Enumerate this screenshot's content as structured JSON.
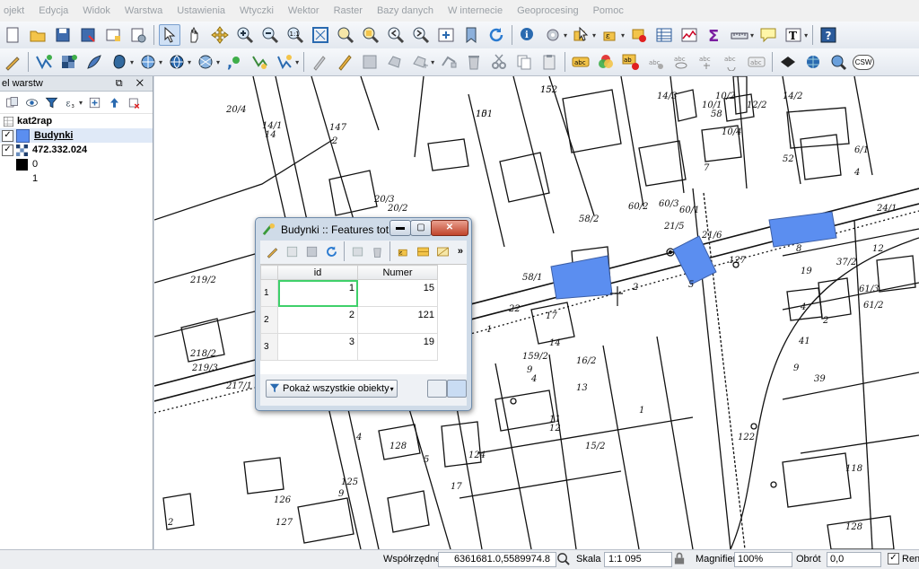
{
  "menu": [
    "ojekt",
    "Edycja",
    "Widok",
    "Warstwa",
    "Ustawienia",
    "Wtyczki",
    "Wektor",
    "Raster",
    "Bazy danych",
    "W internecie",
    "Geoprocesing",
    "Pomoc"
  ],
  "toolbar2": {
    "csw_label": "CSW"
  },
  "layers_panel": {
    "title": "el warstw",
    "controls": "⧉ ✕",
    "layers": [
      {
        "name": "kat2rap",
        "checked": false,
        "visible_check": false
      },
      {
        "name": "Budynki",
        "checked": true,
        "color": "#5b8ef0"
      },
      {
        "name": "472.332.024",
        "checked": true
      },
      {
        "legend": "0",
        "color": "#000000"
      },
      {
        "legend": "1",
        "color": "#ffffff"
      }
    ]
  },
  "attribute_window": {
    "title": "Budynki :: Features tot...",
    "more": "»",
    "columns": [
      "id",
      "Numer"
    ],
    "rows": [
      {
        "row": "1",
        "id": "1",
        "numer": "15"
      },
      {
        "row": "2",
        "id": "2",
        "numer": "121"
      },
      {
        "row": "3",
        "id": "3",
        "numer": "19"
      }
    ],
    "filter_label": "Pokaż wszystkie obiekty"
  },
  "map_labels": [
    "152",
    "151",
    "147",
    "2",
    "14",
    "14/1",
    "20/4",
    "219/2",
    "219/3",
    "218/2",
    "217/1",
    "3",
    "58/1",
    "20/3",
    "20/2",
    "58/2",
    "60/2",
    "60/3",
    "60/1",
    "9",
    "14/3",
    "10/1",
    "10/2",
    "14/2",
    "10/4",
    "12/2",
    "58",
    "7",
    "21/6",
    "21/5",
    "127",
    "5",
    "2",
    "17",
    "1",
    "22",
    "4",
    "9",
    "14",
    "13",
    "16/2",
    "11",
    "12",
    "15/2",
    "17",
    "159/2",
    "125",
    "9",
    "4",
    "5",
    "126",
    "128",
    "124",
    "127",
    "2",
    "3",
    "128",
    "118",
    "37/2",
    "61/3",
    "61/2",
    "8",
    "41",
    "9",
    "39",
    "4",
    "2",
    "1",
    "122",
    "19",
    "52",
    "12",
    "24/1",
    "6/1",
    "4",
    "15",
    "10"
  ],
  "status": {
    "coords_label": "Współrzędne",
    "coords_value": "6361681.0,5589974.8",
    "scale_label": "Skala",
    "scale_value": "1:1 095",
    "magnifier_label": "Magnifier",
    "magnifier_value": "100%",
    "rotation_label": "Obrót",
    "rotation_value": "0,0",
    "render_label": "Rend"
  },
  "colors": {
    "building_fill": "#5b8ef0",
    "selection_outline": "#3fd06a"
  }
}
